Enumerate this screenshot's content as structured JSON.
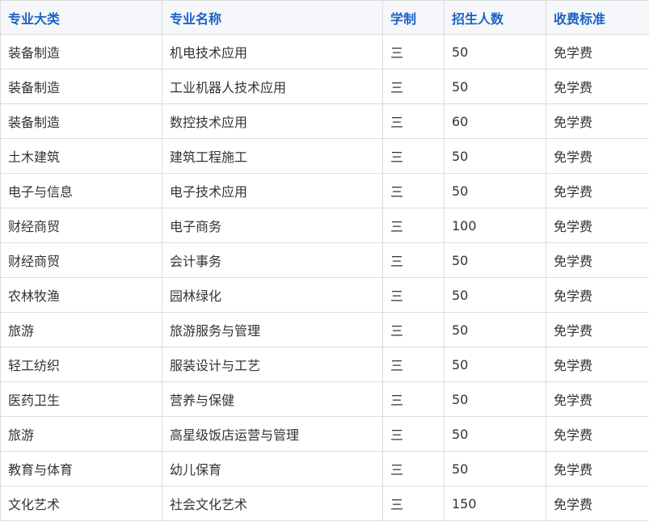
{
  "table": {
    "headers": [
      "专业大类",
      "专业名称",
      "学制",
      "招生人数",
      "收费标准"
    ],
    "rows": [
      [
        "装备制造",
        "机电技术应用",
        "三",
        "50",
        "免学费"
      ],
      [
        "装备制造",
        "工业机器人技术应用",
        "三",
        "50",
        "免学费"
      ],
      [
        "装备制造",
        "数控技术应用",
        "三",
        "60",
        "免学费"
      ],
      [
        "土木建筑",
        "建筑工程施工",
        "三",
        "50",
        "免学费"
      ],
      [
        "电子与信息",
        "电子技术应用",
        "三",
        "50",
        "免学费"
      ],
      [
        "财经商贸",
        "电子商务",
        "三",
        "100",
        "免学费"
      ],
      [
        "财经商贸",
        "会计事务",
        "三",
        "50",
        "免学费"
      ],
      [
        "农林牧渔",
        "园林绿化",
        "三",
        "50",
        "免学费"
      ],
      [
        "旅游",
        "旅游服务与管理",
        "三",
        "50",
        "免学费"
      ],
      [
        "轻工纺织",
        "服装设计与工艺",
        "三",
        "50",
        "免学费"
      ],
      [
        "医药卫生",
        "营养与保健",
        "三",
        "50",
        "免学费"
      ],
      [
        "旅游",
        "高星级饭店运营与管理",
        "三",
        "50",
        "免学费"
      ],
      [
        "教育与体育",
        "幼儿保育",
        "三",
        "50",
        "免学费"
      ],
      [
        "文化艺术",
        "社会文化艺术",
        "三",
        "150",
        "免学费"
      ]
    ]
  },
  "colors": {
    "header_text": "#1b63c6",
    "header_bg": "#f5f7fa",
    "border": "#dcdcdc",
    "body_text": "#333333"
  }
}
